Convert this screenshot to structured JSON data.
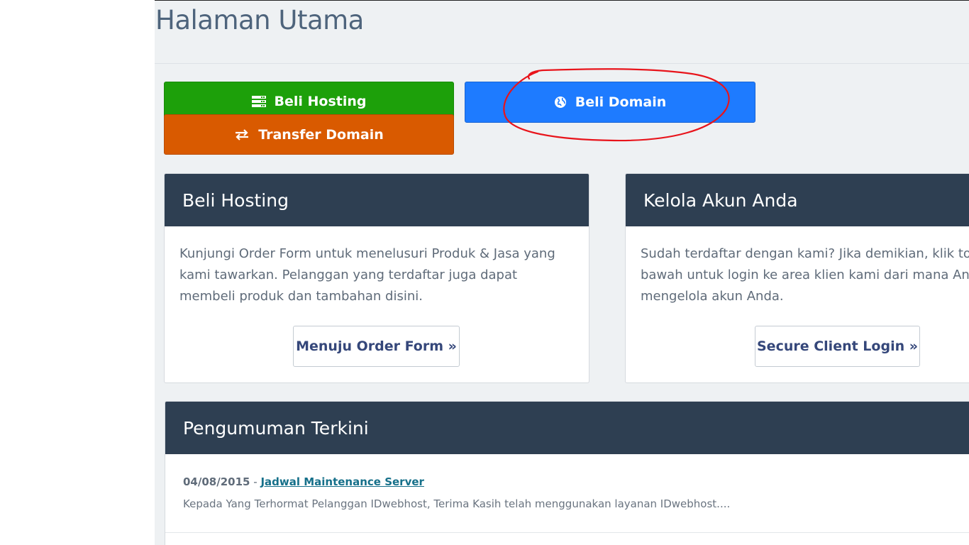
{
  "page": {
    "title": "Halaman Utama"
  },
  "actions": {
    "buy_hosting": {
      "label": "Beli Hosting",
      "icon": "server-icon",
      "color": "#1da00a"
    },
    "transfer_domain": {
      "label": "Transfer Domain",
      "icon": "transfer-arrows-icon",
      "color": "#d95a00"
    },
    "buy_domain": {
      "label": "Beli Domain",
      "icon": "globe-icon",
      "color": "#1e7bff"
    }
  },
  "panels": {
    "hosting": {
      "title": "Beli Hosting",
      "text": "Kunjungi Order Form untuk menelusuri Produk & Jasa yang kami tawarkan. Pelanggan yang terdaftar juga dapat membeli produk dan tambahan disini.",
      "button": "Menuju Order Form »"
    },
    "account": {
      "title": "Kelola Akun Anda",
      "text_lines": [
        "Sudah terdaftar dengan kami? Jika demikian, klik tomb",
        "bawah untuk login ke area klien kami dari mana Anda",
        "mengelola akun Anda."
      ],
      "button": "Secure Client Login »"
    },
    "announcements": {
      "title": "Pengumuman Terkini",
      "items": [
        {
          "date": "04/08/2015",
          "separator": "-",
          "title": "Jadwal Maintenance Server",
          "excerpt": "Kepada Yang Terhormat Pelanggan IDwebhost, Terima Kasih telah menggunakan layanan IDwebhost...."
        }
      ]
    }
  },
  "colors": {
    "panel_header": "#2e3f52",
    "annotation": "#e8141b"
  }
}
